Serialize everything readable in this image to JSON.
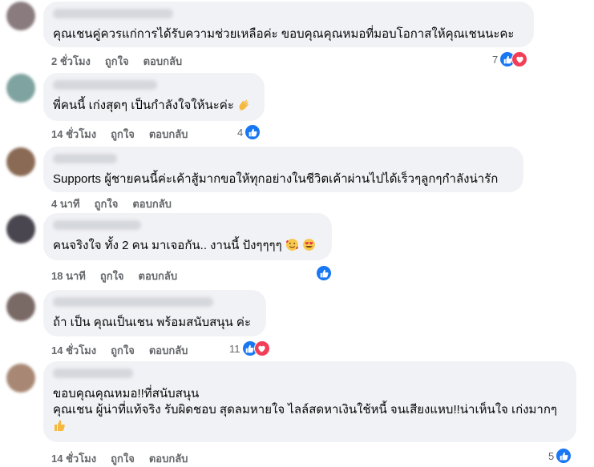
{
  "actions": {
    "like": "ถูกใจ",
    "reply": "ตอบกลับ"
  },
  "comments": [
    {
      "text": "คุณเชนคู่ควรแก่การได้รับความช่วยเหลือค่ะ ขอบคุณคุณหมอที่มอบโอกาสให้คุณเชนนะคะ",
      "time": "2 ชั่วโมง",
      "reaction_count": "7",
      "reactions": [
        "like-icon",
        "love-icon"
      ]
    },
    {
      "text": "พี่คนนี้ เก่งสุดๆ เป็นกำลังใจให้นะค่ะ",
      "time": "14 ชั่วโมง",
      "reaction_count": "4",
      "reactions": [
        "like-icon"
      ]
    },
    {
      "text": "Supports ผู้ชายคนนี้ค่ะเค้าสู้มากขอให้ทุกอย่างในชีวิตเค้าผ่านไปได้เร็วๆลูกๆกำลังน่ารัก",
      "time": "4 นาที",
      "reaction_count": "",
      "reactions": []
    },
    {
      "text": "คนจริงใจ ทั้ง 2 คน มาเจอกัน.. งานนี้ ปังๆๆๆๆ",
      "time": "18 นาที",
      "reaction_count": "",
      "reactions": [
        "like-icon"
      ]
    },
    {
      "text": "ถ้า เป็น คุณเป็นเชน พร้อมสนับสนุน ค่ะ",
      "time": "14 ชั่วโมง",
      "reaction_count": "11",
      "reactions": [
        "like-icon",
        "love-icon"
      ]
    },
    {
      "line1": "ขอบคุณคุณหมอ!!ที่สนับสนุน",
      "line2": "คุณเชน ผู้น่าที่แท้จริง รับผิดชอบ สุดลมหายใจ ไลล์สดหาเงินใช้หนี้ จนเสียงแหบ!!น่าเห็นใจ เก่งมากๆ",
      "time": "14 ชั่วโมง",
      "reaction_count": "5",
      "reactions": [
        "like-icon"
      ]
    }
  ],
  "colors": {
    "like": "#1877f2",
    "love": "#f33e58",
    "bubble": "#f0f2f5",
    "meta": "#65676b"
  }
}
